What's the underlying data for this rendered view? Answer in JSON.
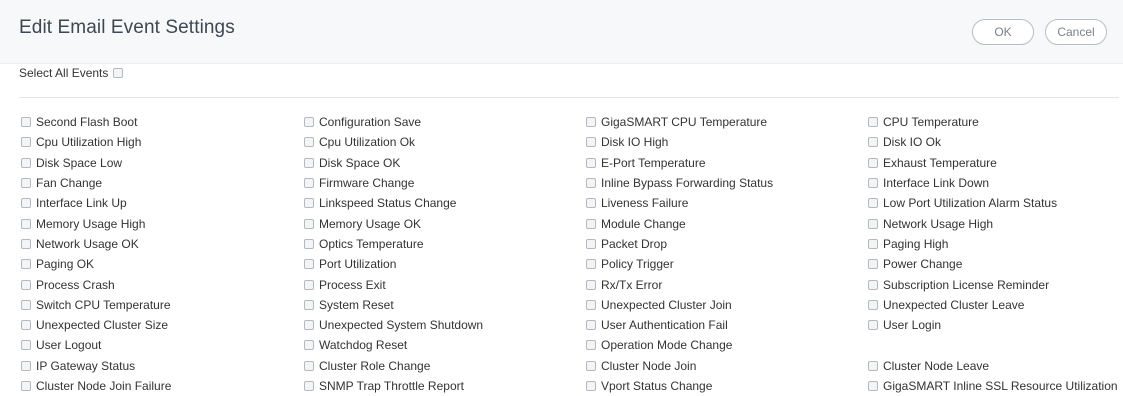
{
  "header": {
    "title": "Edit Email Event Settings",
    "ok_label": "OK",
    "cancel_label": "Cancel"
  },
  "select_all": {
    "label": "Select All Events",
    "checked": false
  },
  "events": [
    "Second Flash Boot",
    "Configuration Save",
    "GigaSMART CPU Temperature",
    "CPU Temperature",
    "Cpu Utilization High",
    "Cpu Utilization Ok",
    "Disk IO High",
    "Disk IO Ok",
    "Disk Space Low",
    "Disk Space OK",
    "E-Port Temperature",
    "Exhaust Temperature",
    "Fan Change",
    "Firmware Change",
    "Inline Bypass Forwarding Status",
    "Interface Link Down",
    "Interface Link Up",
    "Linkspeed Status Change",
    "Liveness Failure",
    "Low Port Utilization Alarm Status",
    "Memory Usage High",
    "Memory Usage OK",
    "Module Change",
    "Network Usage High",
    "Network Usage OK",
    "Optics Temperature",
    "Packet Drop",
    "Paging High",
    "Paging OK",
    "Port Utilization",
    "Policy Trigger",
    "Power Change",
    "Process Crash",
    "Process Exit",
    "Rx/Tx Error",
    "Subscription License Reminder",
    "Switch CPU Temperature",
    "System Reset",
    "Unexpected Cluster Join",
    "Unexpected Cluster Leave",
    "Unexpected Cluster Size",
    "Unexpected System Shutdown",
    "User Authentication Fail",
    "User Login",
    "User Logout",
    "Watchdog Reset",
    "Operation Mode Change",
    "",
    "IP Gateway Status",
    "Cluster Role Change",
    "Cluster Node Join",
    "Cluster Node Leave",
    "Cluster Node Join Failure",
    "SNMP Trap Throttle Report",
    "Vport Status Change",
    "GigaSMART Inline SSL Resource Utilization"
  ]
}
